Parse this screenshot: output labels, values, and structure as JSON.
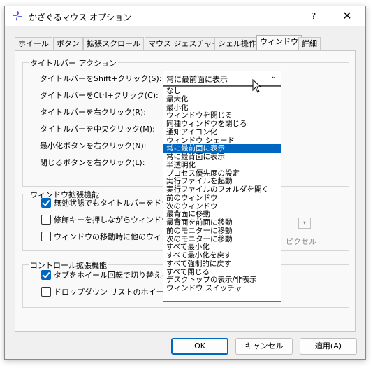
{
  "window": {
    "title": "かざぐるマウス オプション",
    "help_label": "?",
    "close_label": "✕"
  },
  "tabs": [
    {
      "label": "ホイール",
      "active": false
    },
    {
      "label": "ボタン",
      "active": false
    },
    {
      "label": "拡張スクロール",
      "active": false
    },
    {
      "label": "マウス ジェスチャー",
      "active": false
    },
    {
      "label": "シェル操作",
      "active": false
    },
    {
      "label": "ウィンドウ",
      "active": true
    },
    {
      "label": "詳細",
      "active": false
    }
  ],
  "titlebar_action": {
    "group_title": "タイトルバー アクション",
    "rows": [
      "タイトルバーをShift+クリック(S):",
      "タイトルバーをCtrl+クリック(C):",
      "タイトルバーを右クリック(R):",
      "タイトルバーを中央クリック(M):",
      "最小化ボタンを右クリック(N):",
      "閉じるボタンを右クリック(L):"
    ],
    "combo_value": "常に最前面に表示"
  },
  "dropdown": {
    "options": [
      "なし",
      "最大化",
      "最小化",
      "ウィンドウを閉じる",
      "同種ウィンドウを閉じる",
      "通知アイコン化",
      "ウィンドウ シェード",
      "常に最前面に表示",
      "常に最背面に表示",
      "半透明化",
      "プロセス優先度の設定",
      "実行ファイルを起動",
      "実行ファイルのフォルダを開く",
      "前のウィンドウ",
      "次のウィンドウ",
      "最背面に移動",
      "最背面を前面に移動",
      "前のモニターに移動",
      "次のモニターに移動",
      "すべて最小化",
      "すべて最小化を戻す",
      "すべて強制的に戻す",
      "すべて閉じる",
      "デスクトップの表示/非表示",
      "ウィンドウ スイッチャ"
    ],
    "selected_index": 7
  },
  "window_ext": {
    "group_title": "ウィンドウ拡張機能",
    "items": [
      {
        "label": "無効状態でもタイトルバーをドラッグ",
        "checked": true
      },
      {
        "label": "修飾キーを押しながらウィンドウ内を",
        "checked": false
      },
      {
        "label": "ウィンドウの移動時に他のウィンドウ",
        "checked": false
      }
    ],
    "unit_label": "ピクセル"
  },
  "control_ext": {
    "group_title": "コントロール拡張機能",
    "items": [
      {
        "label": "タブをホイール回転で切り替える(E",
        "checked": true
      },
      {
        "label": "ドロップダウン リストのホイールによる",
        "checked": false
      }
    ]
  },
  "footer": {
    "ok": "OK",
    "cancel": "キャンセル",
    "apply": "適用(A)"
  },
  "colors": {
    "accent": "#0067c0",
    "dialog_bg": "#f0f0f0",
    "panel_bg": "#f9f9f9"
  }
}
